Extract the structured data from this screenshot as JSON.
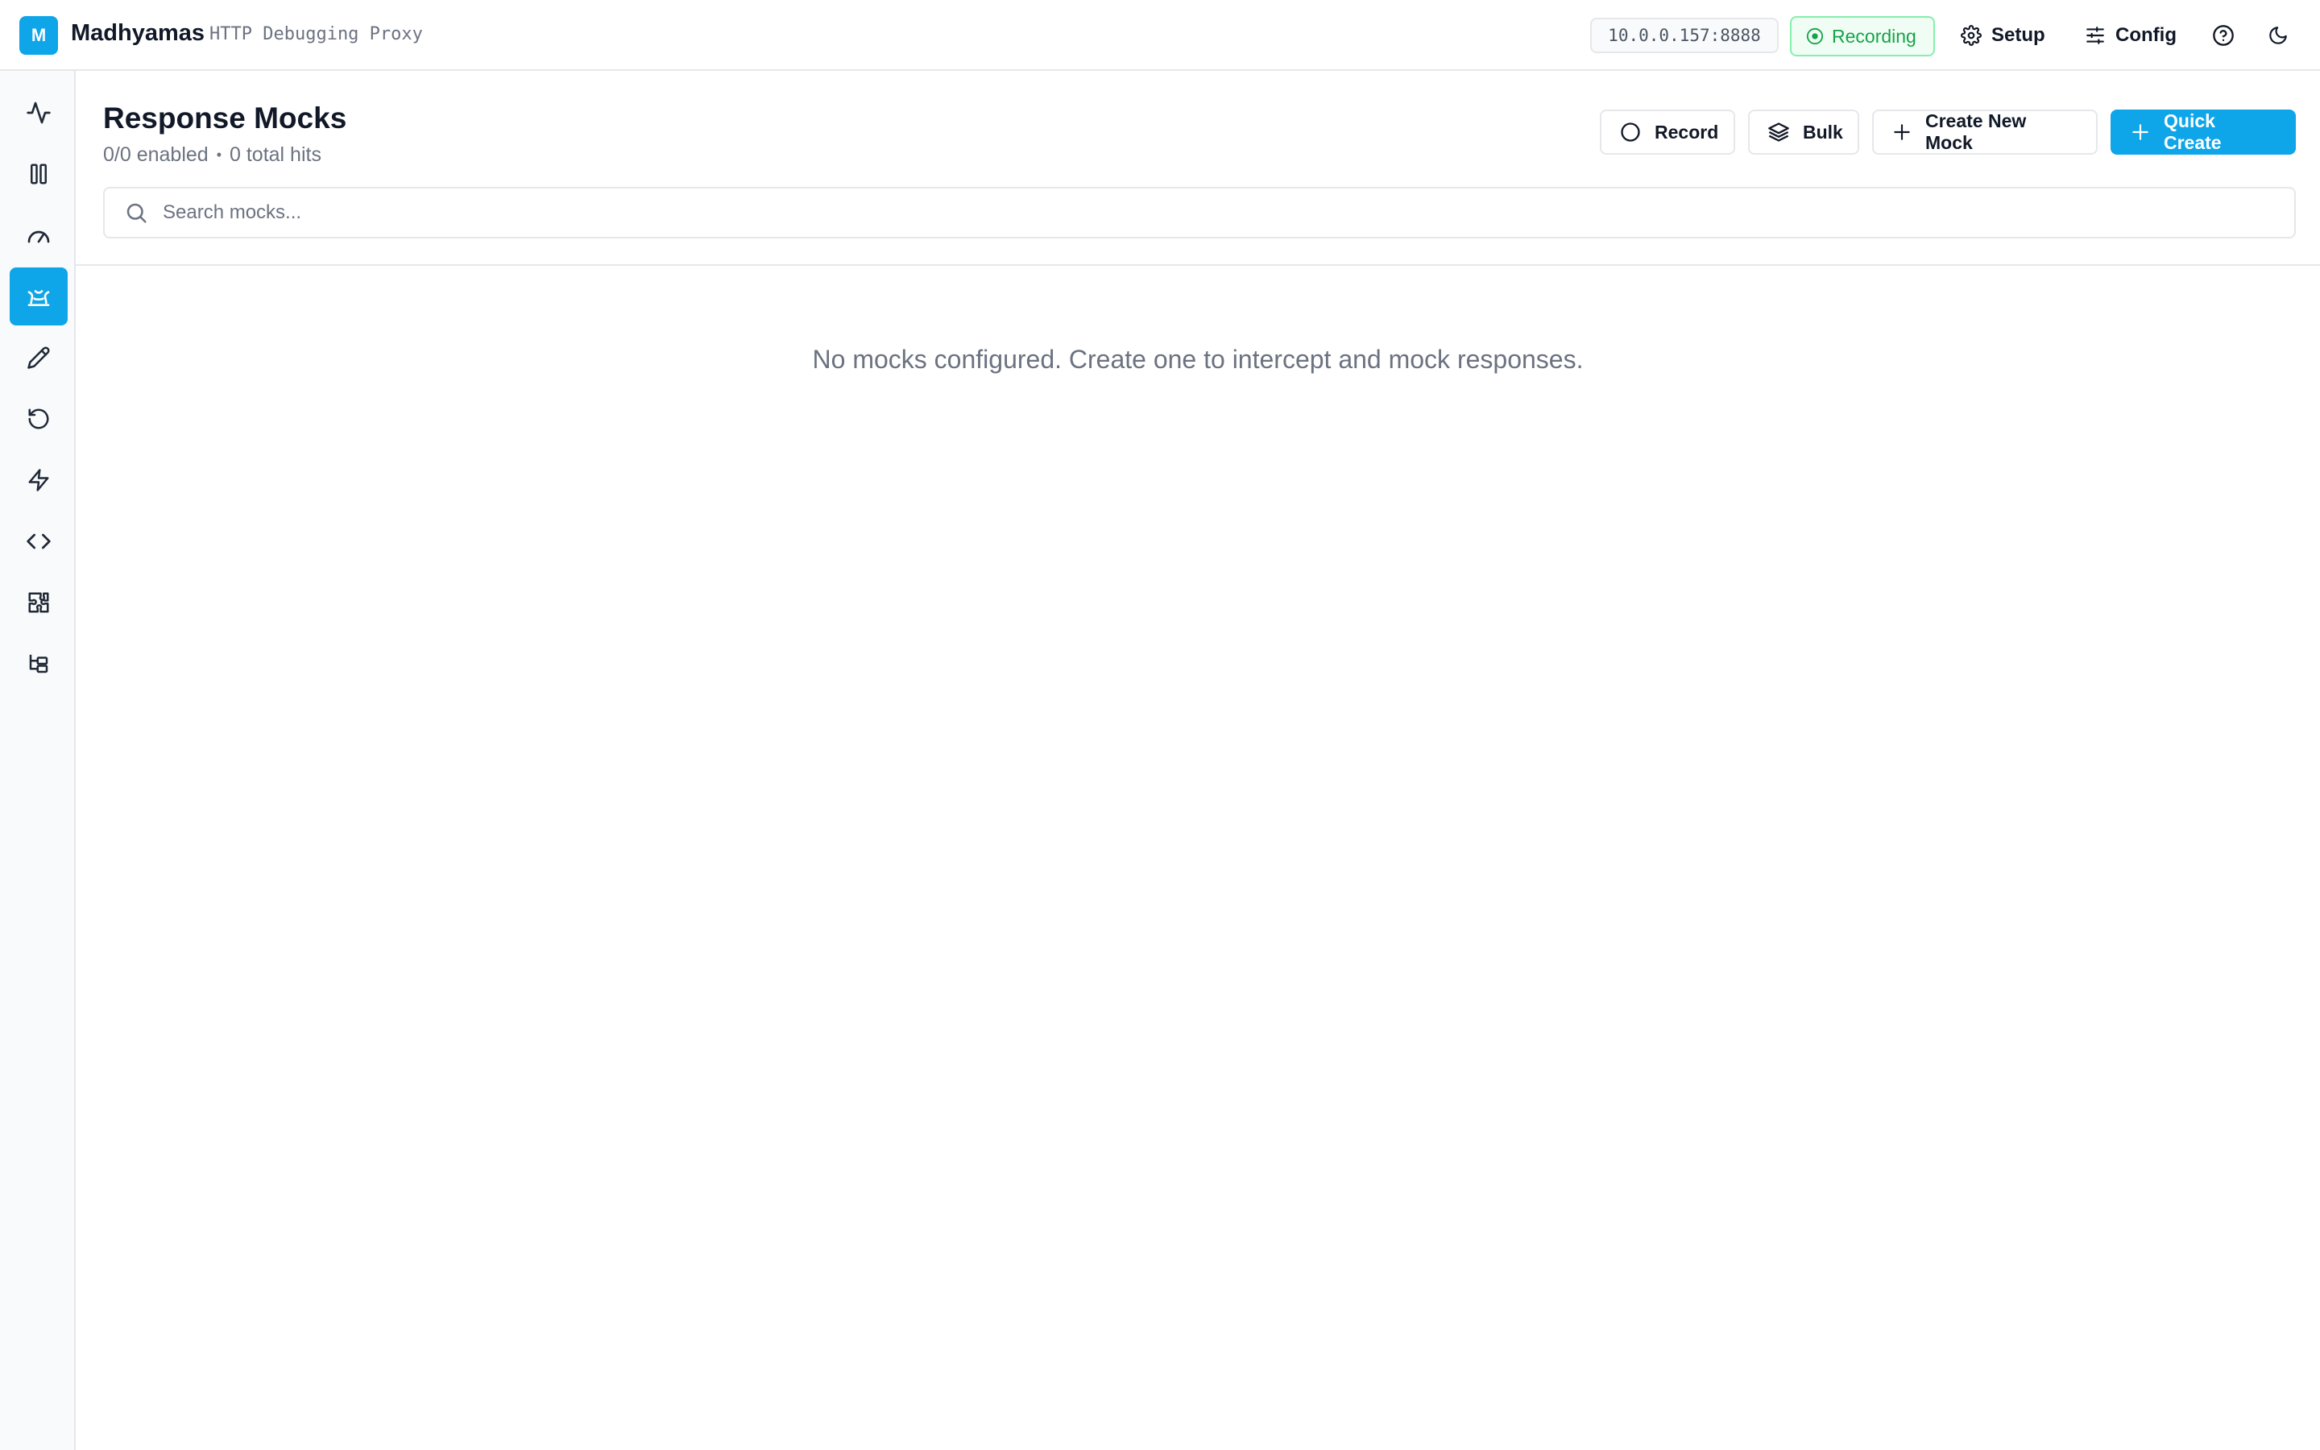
{
  "app": {
    "logo_letter": "M",
    "name": "Madhyamas",
    "subtitle": "HTTP Debugging Proxy"
  },
  "topbar": {
    "address": "10.0.0.157:8888",
    "recording_label": "Recording",
    "setup_label": "Setup",
    "config_label": "Config",
    "help_icon": "help-circle-icon",
    "theme_icon": "moon-icon"
  },
  "sidebar": {
    "items": [
      {
        "name": "traffic",
        "icon": "activity-icon",
        "active": false
      },
      {
        "name": "split",
        "icon": "columns-icon",
        "active": false
      },
      {
        "name": "performance",
        "icon": "gauge-icon",
        "active": false
      },
      {
        "name": "mocks",
        "icon": "mock-icon",
        "active": true
      },
      {
        "name": "edit",
        "icon": "pencil-icon",
        "active": false
      },
      {
        "name": "replay",
        "icon": "rotate-ccw-icon",
        "active": false
      },
      {
        "name": "automation",
        "icon": "zap-icon",
        "active": false
      },
      {
        "name": "code",
        "icon": "code-icon",
        "active": false
      },
      {
        "name": "plugins",
        "icon": "puzzle-icon",
        "active": false
      },
      {
        "name": "tree",
        "icon": "tree-icon",
        "active": false
      }
    ]
  },
  "page": {
    "title": "Response Mocks",
    "enabled_count": "0/0 enabled",
    "separator": "•",
    "hits": "0 total hits",
    "buttons": {
      "record": "Record",
      "bulk": "Bulk",
      "create_new": "Create New Mock",
      "quick_create": "Quick Create"
    },
    "search": {
      "placeholder": "Search mocks...",
      "value": ""
    },
    "empty_message": "No mocks configured. Create one to intercept and mock responses."
  },
  "colors": {
    "accent": "#0ea5e9",
    "recording": "#16a34a",
    "border": "#e5e7eb",
    "muted_text": "#6b7280"
  }
}
